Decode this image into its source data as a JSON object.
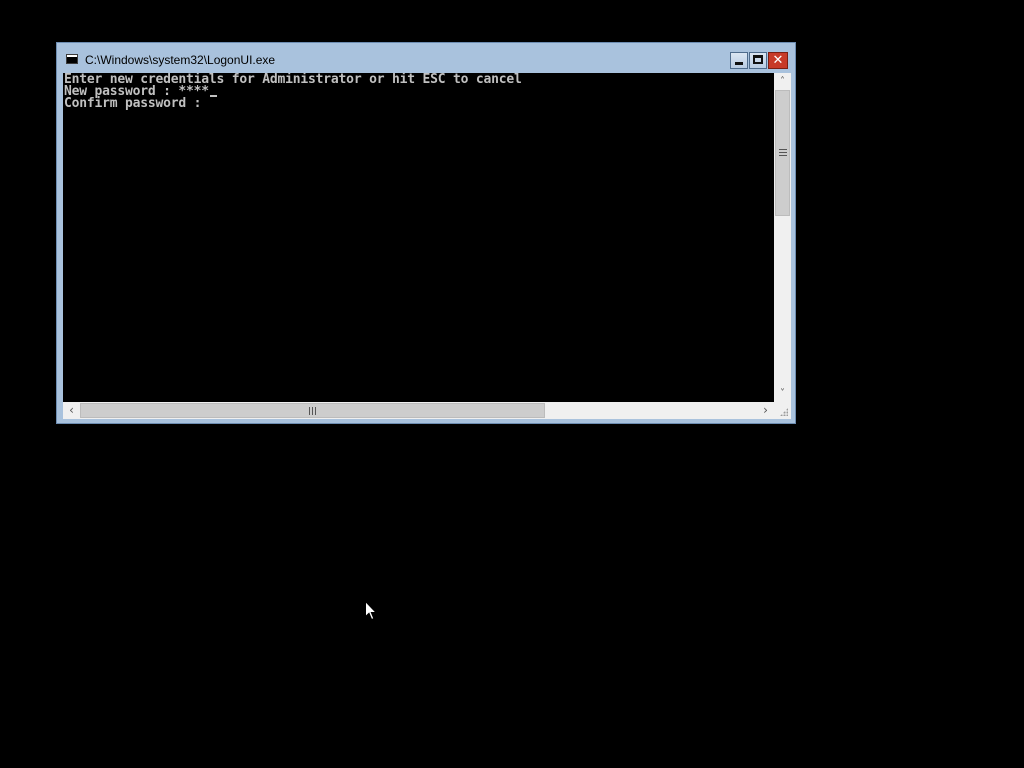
{
  "window": {
    "title": "C:\\Windows\\system32\\LogonUI.exe",
    "controls": {
      "minimize": "minimize",
      "maximize": "maximize",
      "close": "✕"
    }
  },
  "console": {
    "lines": [
      "Enter new credentials for Administrator or hit ESC to cancel",
      "New password : ****",
      "Confirm password :"
    ]
  },
  "scrollbars": {
    "vertical": {
      "up_arrow": "˄",
      "down_arrow": "˅"
    },
    "horizontal": {
      "left_arrow": "‹",
      "right_arrow": "›"
    }
  },
  "colors": {
    "desktop_background": "#000000",
    "window_frame": "#a9c2dd",
    "console_background": "#000000",
    "console_text": "#c0c0c0",
    "close_button": "#c73a28"
  },
  "icons": [
    "console-app-icon",
    "minimize-icon",
    "maximize-icon",
    "close-icon",
    "mouse-pointer-icon"
  ]
}
